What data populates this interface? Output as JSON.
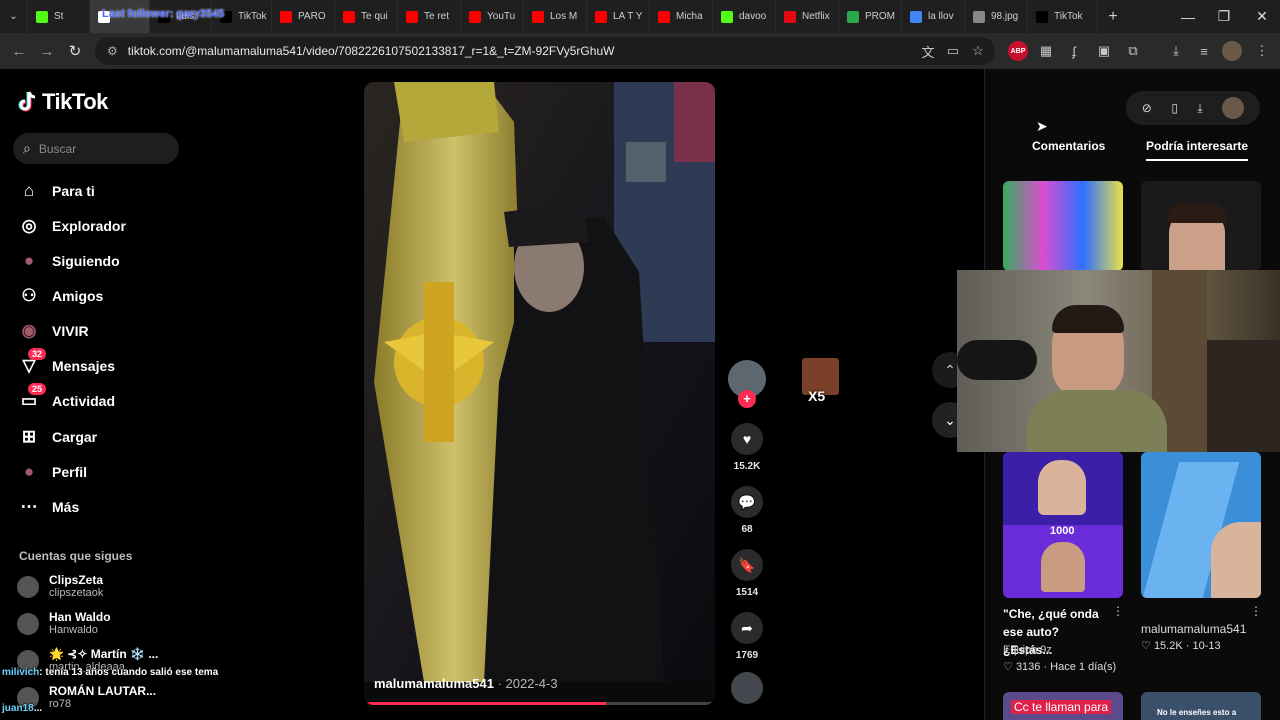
{
  "browser": {
    "tabs": [
      {
        "title": "St",
        "color": "#53fc18"
      },
      {
        "title": "",
        "color": "#ffffff"
      },
      {
        "title": "Luis",
        "color": "#000000"
      },
      {
        "title": "TikTok",
        "color": "#000000"
      },
      {
        "title": "PARO",
        "color": "#ff0000"
      },
      {
        "title": "Te qui",
        "color": "#ff0000"
      },
      {
        "title": "Te ret",
        "color": "#ff0000"
      },
      {
        "title": "YouTu",
        "color": "#ff0000"
      },
      {
        "title": "Los M",
        "color": "#ff0000"
      },
      {
        "title": "LA T Y",
        "color": "#ff0000"
      },
      {
        "title": "Micha",
        "color": "#ff0000"
      },
      {
        "title": "davoo",
        "color": "#53fc18"
      },
      {
        "title": "Netflix",
        "color": "#e50914"
      },
      {
        "title": "PROM",
        "color": "#2aa84a"
      },
      {
        "title": "la llov",
        "color": "#4285f4"
      },
      {
        "title": "98.jpg",
        "color": "#888888"
      },
      {
        "title": "TikTok",
        "color": "#000000"
      }
    ],
    "url": "tiktok.com/@malumamaluma541/video/7082226107502133817_r=1&_t=ZM-92FVy5rGhuW",
    "stream_overlay_text": "Last follower: gary3545"
  },
  "sidebar": {
    "logo": "TikTok",
    "search_placeholder": "Buscar",
    "items": [
      {
        "label": "Para ti",
        "icon": "home-icon",
        "badge": ""
      },
      {
        "label": "Explorador",
        "icon": "compass-icon",
        "badge": ""
      },
      {
        "label": "Siguiendo",
        "icon": "following-avatar-icon",
        "badge": ""
      },
      {
        "label": "Amigos",
        "icon": "friends-icon",
        "badge": ""
      },
      {
        "label": "VIVIR",
        "icon": "live-icon",
        "badge": ""
      },
      {
        "label": "Mensajes",
        "icon": "messages-icon",
        "badge": "32"
      },
      {
        "label": "Actividad",
        "icon": "activity-icon",
        "badge": "25"
      },
      {
        "label": "Cargar",
        "icon": "upload-icon",
        "badge": ""
      },
      {
        "label": "Perfil",
        "icon": "profile-icon",
        "badge": ""
      },
      {
        "label": "Más",
        "icon": "more-icon",
        "badge": ""
      }
    ],
    "following_title": "Cuentas que sigues",
    "following": [
      {
        "name": "ClipsZeta",
        "username": "clipszetaok"
      },
      {
        "name": "Han Waldo",
        "username": "Hanwaldo"
      },
      {
        "name": "🌟 ⊰✧ Martín ❄️ ...",
        "username": "martin_aldeaaa"
      },
      {
        "name": "ROMÁN LAUTAR...",
        "username": "ro78"
      }
    ]
  },
  "video": {
    "author": "malumamaluma541",
    "date": "2022-4-3",
    "progress": 0.69
  },
  "actions": {
    "likes": "15.2K",
    "comments": "68",
    "saves": "1514",
    "shares": "1769"
  },
  "emote_label": "X5",
  "right_panel": {
    "tabs": [
      "Comentarios",
      "Podría interesarte"
    ],
    "cards": [
      {
        "title": "\"Che, ¿qué onda ese auto? ¿Estás...",
        "author": "Equipo 9z",
        "stats": "3136 · Hace 1 día(s)",
        "overlay": "1000"
      },
      {
        "title": "",
        "author": "malumamaluma541",
        "stats": "15.2K · 10-13",
        "overlay": ""
      }
    ],
    "bottom_cards": [
      "Cc te llaman para",
      "No le enseñes esto a"
    ]
  },
  "chat": [
    {
      "user": "milivich",
      "text": ": tenía 13 años cuando salió ese tema"
    },
    {
      "user": "juan18",
      "text": "..."
    }
  ]
}
